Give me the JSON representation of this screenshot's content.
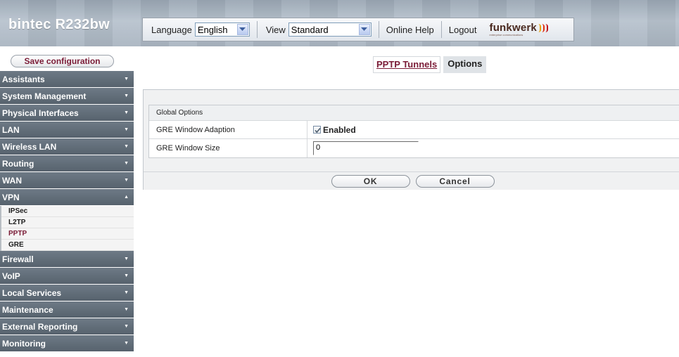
{
  "header": {
    "brand": "bintec R232bw",
    "language_label": "Language",
    "language_value": "English",
    "view_label": "View",
    "view_value": "Standard",
    "online_help": "Online Help",
    "logout": "Logout",
    "logo_text": "funkwerk",
    "logo_sub": "enterprise communications"
  },
  "sidebar": {
    "save_label": "Save configuration",
    "items": [
      {
        "label": "Assistants"
      },
      {
        "label": "System Management"
      },
      {
        "label": "Physical Interfaces"
      },
      {
        "label": "LAN"
      },
      {
        "label": "Wireless LAN"
      },
      {
        "label": "Routing"
      },
      {
        "label": "WAN"
      },
      {
        "label": "VPN"
      },
      {
        "label": "Firewall"
      },
      {
        "label": "VoIP"
      },
      {
        "label": "Local Services"
      },
      {
        "label": "Maintenance"
      },
      {
        "label": "External Reporting"
      },
      {
        "label": "Monitoring"
      }
    ],
    "vpn_sub": [
      "IPSec",
      "L2TP",
      "PPTP",
      "GRE"
    ]
  },
  "tabs": {
    "pptp_tunnels": "PPTP Tunnels",
    "options": "Options"
  },
  "form": {
    "section": "Global Options",
    "gre_window_adaption_label": "GRE Window Adaption",
    "gre_window_adaption_value": "Enabled",
    "gre_window_adaption_checked": true,
    "gre_window_size_label": "GRE Window Size",
    "gre_window_size_value": "0"
  },
  "buttons": {
    "ok": "OK",
    "cancel": "Cancel"
  },
  "colors": {
    "accent": "#7a1b36",
    "menu_bg": "#5e6974"
  }
}
